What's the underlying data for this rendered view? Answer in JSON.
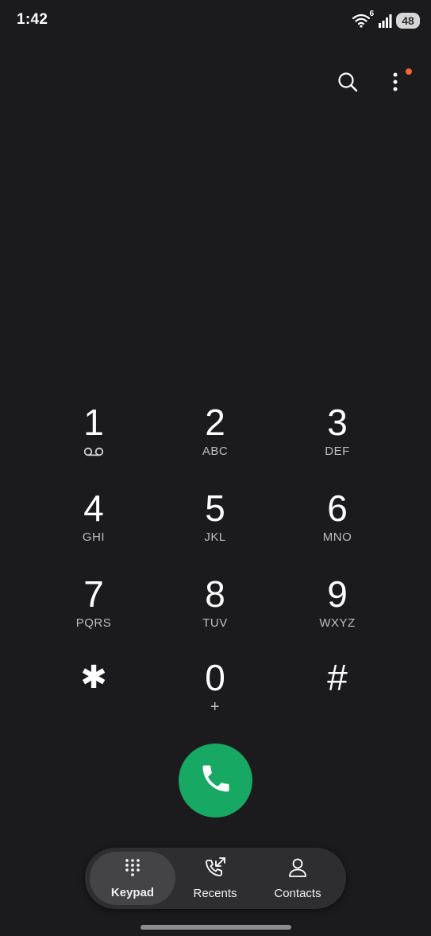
{
  "status_bar": {
    "time": "1:42",
    "network_label": "6",
    "battery_level": "48",
    "icons": [
      "wifi-icon",
      "signal-icon",
      "battery-icon"
    ]
  },
  "top_actions": {
    "icons": [
      "search-icon",
      "more-vert-icon"
    ],
    "notification_dot_color": "#ef6a2d"
  },
  "keypad": {
    "keys": [
      {
        "digit": "1",
        "letters": "",
        "sub_icon": "voicemail-icon"
      },
      {
        "digit": "2",
        "letters": "ABC"
      },
      {
        "digit": "3",
        "letters": "DEF"
      },
      {
        "digit": "4",
        "letters": "GHI"
      },
      {
        "digit": "5",
        "letters": "JKL"
      },
      {
        "digit": "6",
        "letters": "MNO"
      },
      {
        "digit": "7",
        "letters": "PQRS"
      },
      {
        "digit": "8",
        "letters": "TUV"
      },
      {
        "digit": "9",
        "letters": "WXYZ"
      },
      {
        "digit": "✱",
        "letters": ""
      },
      {
        "digit": "0",
        "letters": "+"
      },
      {
        "digit": "#",
        "letters": ""
      }
    ]
  },
  "call_button": {
    "icon": "phone-icon",
    "color": "#17a864"
  },
  "bottom_nav": {
    "items": [
      {
        "label": "Keypad",
        "icon": "keypad-icon",
        "active": true
      },
      {
        "label": "Recents",
        "icon": "recents-icon",
        "active": false
      },
      {
        "label": "Contacts",
        "icon": "contacts-icon",
        "active": false
      }
    ]
  },
  "colors": {
    "background": "#1b1b1d",
    "accent_green": "#17a864",
    "nav_background": "#2e2e30",
    "nav_active": "#444446"
  }
}
